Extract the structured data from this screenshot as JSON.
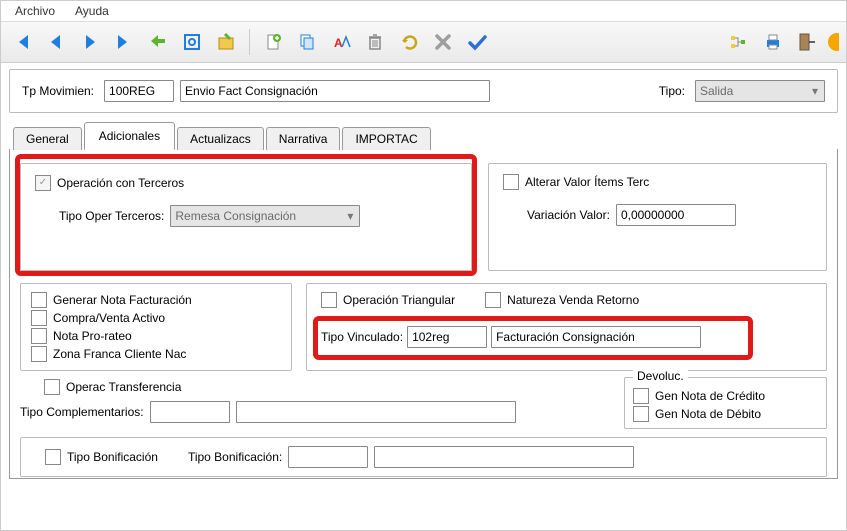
{
  "menu": {
    "file": "Archivo",
    "help": "Ayuda"
  },
  "topfields": {
    "tp_mov_label": "Tp Movimien:",
    "tp_mov_value": "100REG",
    "tp_mov_desc": "Envio Fact Consignación",
    "tipo_label": "Tipo:",
    "tipo_value": "Salida"
  },
  "tabs": {
    "general": "General",
    "adicionales": "Adicionales",
    "actualizacs": "Actualizacs",
    "narrativa": "Narrativa",
    "importac": "IMPORTAC"
  },
  "adic": {
    "op_terceros": "Operación con Terceros",
    "tipo_oper_terc_label": "Tipo Oper Terceros:",
    "tipo_oper_terc_value": "Remesa Consignación",
    "alterar_valor": "Alterar Valor Ítems Terc",
    "variacion_label": "Variación Valor:",
    "variacion_value": "0,00000000",
    "gen_nota_fact": "Generar Nota Facturación",
    "compra_venta": "Compra/Venta Activo",
    "nota_prorateo": "Nota Pro-rateo",
    "zona_franca": "Zona Franca Cliente Nac",
    "operac_transf": "Operac Transferencia",
    "tipo_complementarios_label": "Tipo Complementarios:",
    "op_triangular": "Operación Triangular",
    "nat_venda_retorno": "Natureza Venda Retorno",
    "tipo_vinculado_label": "Tipo Vinculado:",
    "tipo_vinculado_code": "102reg",
    "tipo_vinculado_desc": "Facturación Consignación",
    "devoluc_title": "Devoluc.",
    "gen_nota_credito": "Gen Nota de Crédito",
    "gen_nota_debito": "Gen Nota de Débito",
    "tipo_bonif_label": "Tipo Bonificación",
    "tipo_bonif_label2": "Tipo Bonificación:"
  }
}
